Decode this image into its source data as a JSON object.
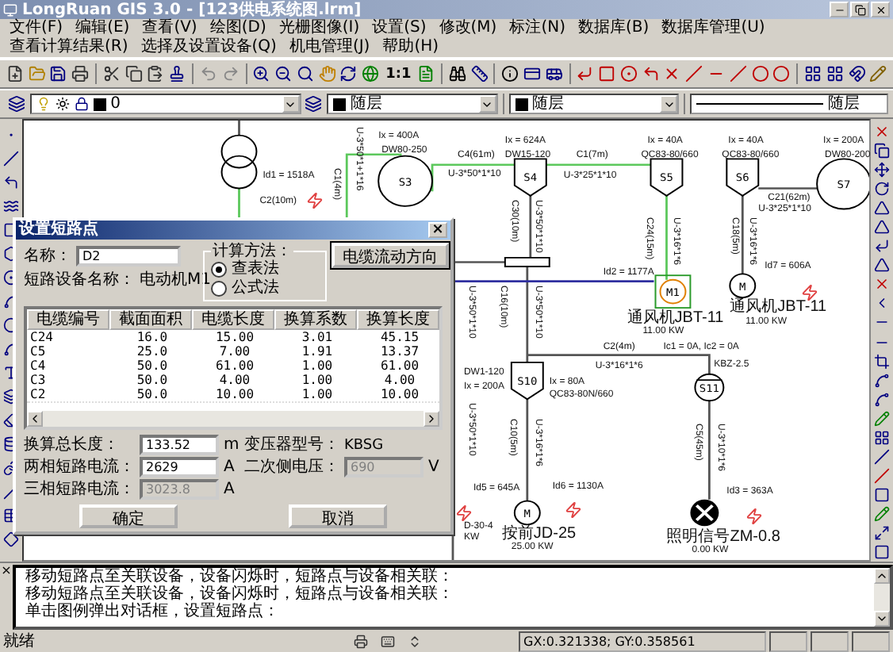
{
  "window": {
    "title": "LongRuan GIS 3.0 - [123供电系统图.lrm]"
  },
  "menu": [
    "文件(F)",
    "编辑(E)",
    "查看(V)",
    "绘图(D)",
    "光栅图像(I)",
    "设置(S)",
    "修改(M)",
    "标注(N)",
    "数据库(B)",
    "数据库管理(U)",
    "查看计算结果(R)",
    "选择及设置设备(Q)",
    "机电管理(J)",
    "帮助(H)"
  ],
  "toolbar": {
    "scale_label": "1:1"
  },
  "layer_bar": {
    "layer": "0",
    "color_setting": "随层",
    "line_color_setting": "随层",
    "linetype": "随层"
  },
  "diagram": {
    "nodes": [
      {
        "kind": "transformer",
        "selected": false
      },
      {
        "kind": "generator",
        "label": "S3",
        "selected": false
      },
      {
        "kind": "switch",
        "label": "S4",
        "selected": false
      },
      {
        "kind": "switch",
        "label": "S5",
        "selected": false
      },
      {
        "kind": "switch",
        "label": "S6",
        "selected": false
      },
      {
        "kind": "generator",
        "label": "S7",
        "selected": false
      },
      {
        "kind": "motor",
        "label": "M1",
        "selected": true
      },
      {
        "kind": "motor",
        "label": "M",
        "selected": false
      },
      {
        "kind": "busbar",
        "selected": false
      },
      {
        "kind": "switch",
        "label": "S10",
        "selected": false
      },
      {
        "kind": "breaker",
        "label": "S11",
        "selected": false
      },
      {
        "kind": "motor",
        "label": "M",
        "selected": false
      },
      {
        "kind": "lamp",
        "selected": false
      }
    ],
    "labels": [
      {
        "text": "Id1 = 1518A",
        "kind": "horizontal"
      },
      {
        "text": "C2(10m)",
        "kind": "horizontal"
      },
      {
        "text": "C1(4m)",
        "kind": "vertical"
      },
      {
        "text": "U-3*50*1+1*16",
        "kind": "vertical"
      },
      {
        "text": "Ix = 400A",
        "kind": "horizontal"
      },
      {
        "text": "DW80-250",
        "kind": "horizontal"
      },
      {
        "text": "C4(61m)",
        "kind": "horizontal"
      },
      {
        "text": "Ix = 624A",
        "kind": "horizontal"
      },
      {
        "text": "DW15-120",
        "kind": "horizontal"
      },
      {
        "text": "U-3*50*1*10",
        "kind": "horizontal"
      },
      {
        "text": "C1(7m)",
        "kind": "horizontal"
      },
      {
        "text": "U-3*25*1*10",
        "kind": "horizontal"
      },
      {
        "text": "Ix = 40A",
        "kind": "horizontal"
      },
      {
        "text": "QC83-80/660",
        "kind": "horizontal"
      },
      {
        "text": "Ix = 40A",
        "kind": "horizontal"
      },
      {
        "text": "QC83-80/660",
        "kind": "horizontal"
      },
      {
        "text": "Ix = 200A",
        "kind": "horizontal"
      },
      {
        "text": "DW80-200",
        "kind": "horizontal"
      },
      {
        "text": "C21(62m)",
        "kind": "horizontal"
      },
      {
        "text": "U-3*25*1*10",
        "kind": "horizontal"
      },
      {
        "text": "C30(10m)",
        "kind": "vertical"
      },
      {
        "text": "U-3*50*1*10",
        "kind": "vertical"
      },
      {
        "text": "C24(15m)",
        "kind": "vertical"
      },
      {
        "text": "U-3*16*1*6",
        "kind": "vertical"
      },
      {
        "text": "C18(5m)",
        "kind": "vertical"
      },
      {
        "text": "U-3*16*1*6",
        "kind": "vertical"
      },
      {
        "text": "Id2 = 1177A",
        "kind": "horizontal"
      },
      {
        "text": "Id7 = 606A",
        "kind": "horizontal"
      },
      {
        "text": "通风机JBT-11",
        "kind": "horizontal"
      },
      {
        "text": "11.00 KW",
        "kind": "horizontal"
      },
      {
        "text": "通风机JBT-11",
        "kind": "horizontal"
      },
      {
        "text": "11.00 KW",
        "kind": "horizontal"
      },
      {
        "text": "U-3*50*1*10",
        "kind": "vertical"
      },
      {
        "text": "C16(10m)",
        "kind": "vertical"
      },
      {
        "text": "U-3*50*1*10",
        "kind": "vertical"
      },
      {
        "text": "C2(4m)",
        "kind": "horizontal"
      },
      {
        "text": "Ic1 = 0A, Ic2 = 0A",
        "kind": "horizontal"
      },
      {
        "text": "KBZ-2.5",
        "kind": "horizontal"
      },
      {
        "text": "U-3*16*1*6",
        "kind": "horizontal"
      },
      {
        "text": "DW1-120",
        "kind": "horizontal"
      },
      {
        "text": "Ix = 200A",
        "kind": "horizontal"
      },
      {
        "text": "Ix = 80A",
        "kind": "horizontal"
      },
      {
        "text": "QC83-80N/660",
        "kind": "horizontal"
      },
      {
        "text": "U-3*50*1*10",
        "kind": "vertical"
      },
      {
        "text": "C10(5m)",
        "kind": "vertical"
      },
      {
        "text": "U-3*16*1*6",
        "kind": "vertical"
      },
      {
        "text": "C5(45m)",
        "kind": "vertical"
      },
      {
        "text": "U-3*10*1*6",
        "kind": "vertical"
      },
      {
        "text": "Id5 = 645A",
        "kind": "horizontal"
      },
      {
        "text": "Id6 = 1130A",
        "kind": "horizontal"
      },
      {
        "text": "Id3 = 363A",
        "kind": "horizontal"
      },
      {
        "text": "D-30-4",
        "kind": "horizontal"
      },
      {
        "text": "KW",
        "kind": "horizontal"
      },
      {
        "text": "按前JD-25",
        "kind": "horizontal"
      },
      {
        "text": "25.00 KW",
        "kind": "horizontal"
      },
      {
        "text": "照明信号ZM-0.8",
        "kind": "horizontal"
      },
      {
        "text": "0.00 KW",
        "kind": "horizontal"
      }
    ]
  },
  "dialog": {
    "title": "设置短路点",
    "close": "×",
    "name_label": "名称：",
    "name_value": "D2",
    "method_label": "计算方法：",
    "methods": [
      {
        "label": "查表法",
        "selected": true
      },
      {
        "label": "公式法",
        "selected": false
      }
    ],
    "direction_button": "电缆流动方向",
    "device_label": "短路设备名称：",
    "device_value": "电动机M1",
    "table": {
      "columns": [
        "电缆编号",
        "截面面积",
        "电缆长度",
        "换算系数",
        "换算长度"
      ],
      "rows": [
        [
          "C24",
          "16.0",
          "15.00",
          "3.01",
          "45.15"
        ],
        [
          "C5",
          "25.0",
          "7.00",
          "1.91",
          "13.37"
        ],
        [
          "C4",
          "50.0",
          "61.00",
          "1.00",
          "61.00"
        ],
        [
          "C3",
          "50.0",
          "4.00",
          "1.00",
          "4.00"
        ],
        [
          "C2",
          "50.0",
          "10.00",
          "1.00",
          "10.00"
        ]
      ]
    },
    "fields": [
      {
        "label": "换算总长度：",
        "kind": "input",
        "value": "133.52",
        "unit": "m",
        "disabled": false
      },
      {
        "label": "变压器型号：",
        "kind": "text",
        "value": "KBSG",
        "disabled": false
      },
      {
        "label": "两相短路电流：",
        "kind": "input",
        "value": "2629",
        "unit": "A",
        "disabled": false
      },
      {
        "label": "二次侧电压：",
        "kind": "input",
        "value": "690",
        "unit": "V",
        "disabled": true
      },
      {
        "label": "三相短路电流：",
        "kind": "input",
        "value": "3023.8",
        "unit": "A",
        "disabled": true
      }
    ],
    "buttons": [
      "确定",
      "取消"
    ]
  },
  "command_panel": {
    "close": "×",
    "lines": [
      "移动短路点至关联设备，设备闪烁时，短路点与设备相关联：",
      "移动短路点至关联设备，设备闪烁时，短路点与设备相关联：",
      "单击图例弹出对话框，设置短路点："
    ]
  },
  "status_bar": {
    "text": "就绪",
    "coordinates": "GX:0.321338; GY:0.358561"
  }
}
